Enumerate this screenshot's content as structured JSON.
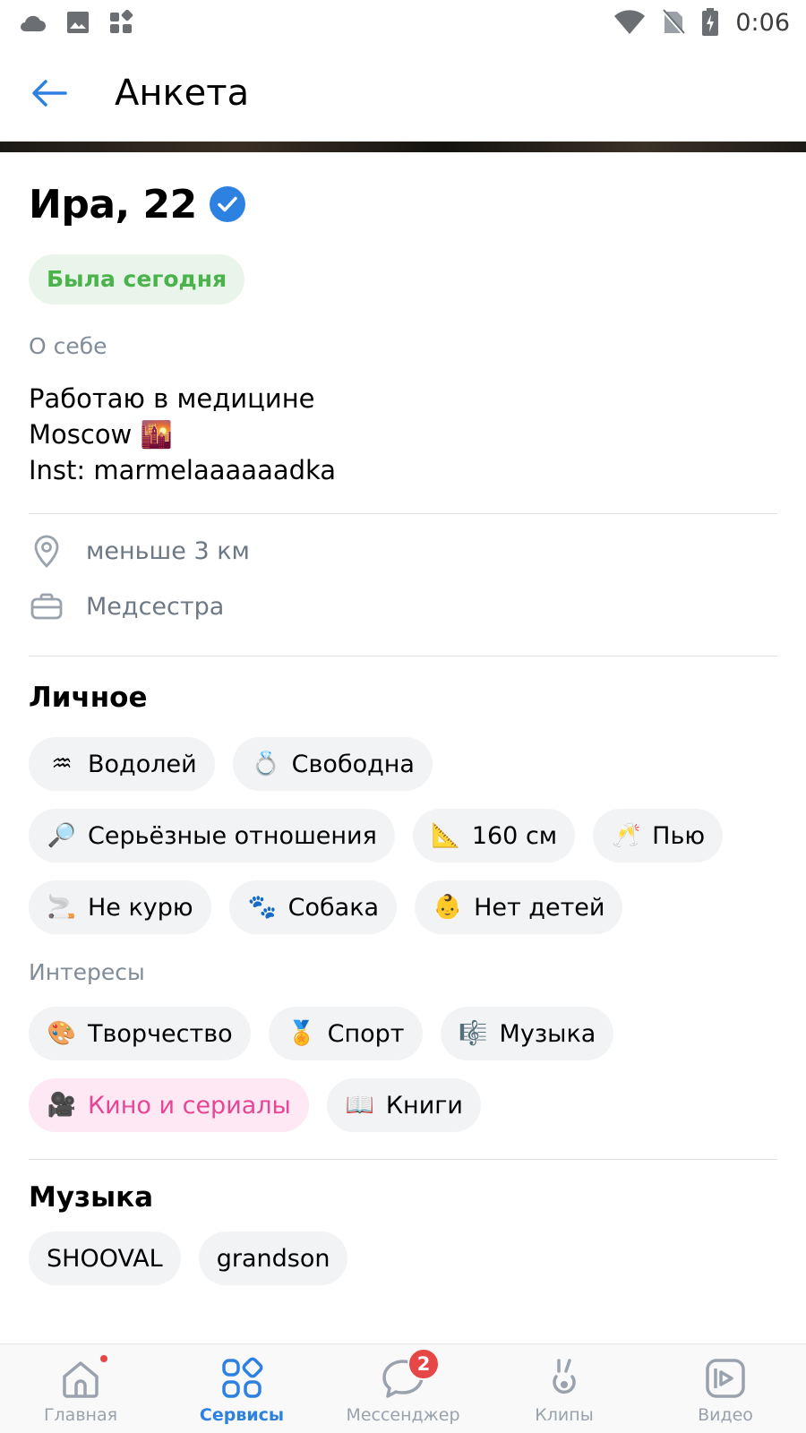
{
  "status_bar": {
    "time": "0:06",
    "left_icons": [
      "cloud-icon",
      "image-icon",
      "widgets-icon"
    ],
    "right_icons": [
      "wifi-icon",
      "no-sim-icon",
      "battery-charging-icon"
    ]
  },
  "header": {
    "title": "Анкета"
  },
  "profile": {
    "name": "Ира, 22",
    "online": "Была сегодня",
    "about_label": "О себе",
    "about_lines": [
      "Работаю в медицине",
      "Moscow 🌇",
      "Inst: marmelaaaaaadka"
    ],
    "distance": "меньше 3 км",
    "job": "Медсестра"
  },
  "personal": {
    "heading": "Личное",
    "chips": [
      {
        "icon": "♒",
        "label": "Водолей"
      },
      {
        "icon": "💍",
        "label": "Свободна"
      },
      {
        "icon": "🔎",
        "label": "Серьёзные отношения"
      },
      {
        "icon": "📐",
        "label": "160 см"
      },
      {
        "icon": "🥂",
        "label": "Пью"
      },
      {
        "icon": "🚬",
        "label": "Не курю"
      },
      {
        "icon": "🐾",
        "label": "Собака"
      },
      {
        "icon": "👶",
        "label": "Нет детей"
      }
    ]
  },
  "interests": {
    "label": "Интересы",
    "chips": [
      {
        "icon": "🎨",
        "label": "Творчество"
      },
      {
        "icon": "🏅",
        "label": "Спорт"
      },
      {
        "icon": "🎼",
        "label": "Музыка"
      },
      {
        "icon": "🎥",
        "label": "Кино и сериалы"
      },
      {
        "icon": "📖",
        "label": "Книги"
      }
    ]
  },
  "music": {
    "heading": "Музыка",
    "chips": [
      "SHOOVAL",
      "grandson"
    ]
  },
  "bottom_nav": {
    "items": [
      {
        "label": "Главная",
        "icon": "home-icon"
      },
      {
        "label": "Сервисы",
        "icon": "services-icon"
      },
      {
        "label": "Мессенджер",
        "icon": "messenger-icon",
        "badge": "2"
      },
      {
        "label": "Клипы",
        "icon": "clips-icon"
      },
      {
        "label": "Видео",
        "icon": "video-icon"
      }
    ]
  },
  "colors": {
    "accent": "#2d81e0",
    "online_green": "#4bb34b",
    "active_chip": "#e64694",
    "badge_red": "#e64646"
  }
}
